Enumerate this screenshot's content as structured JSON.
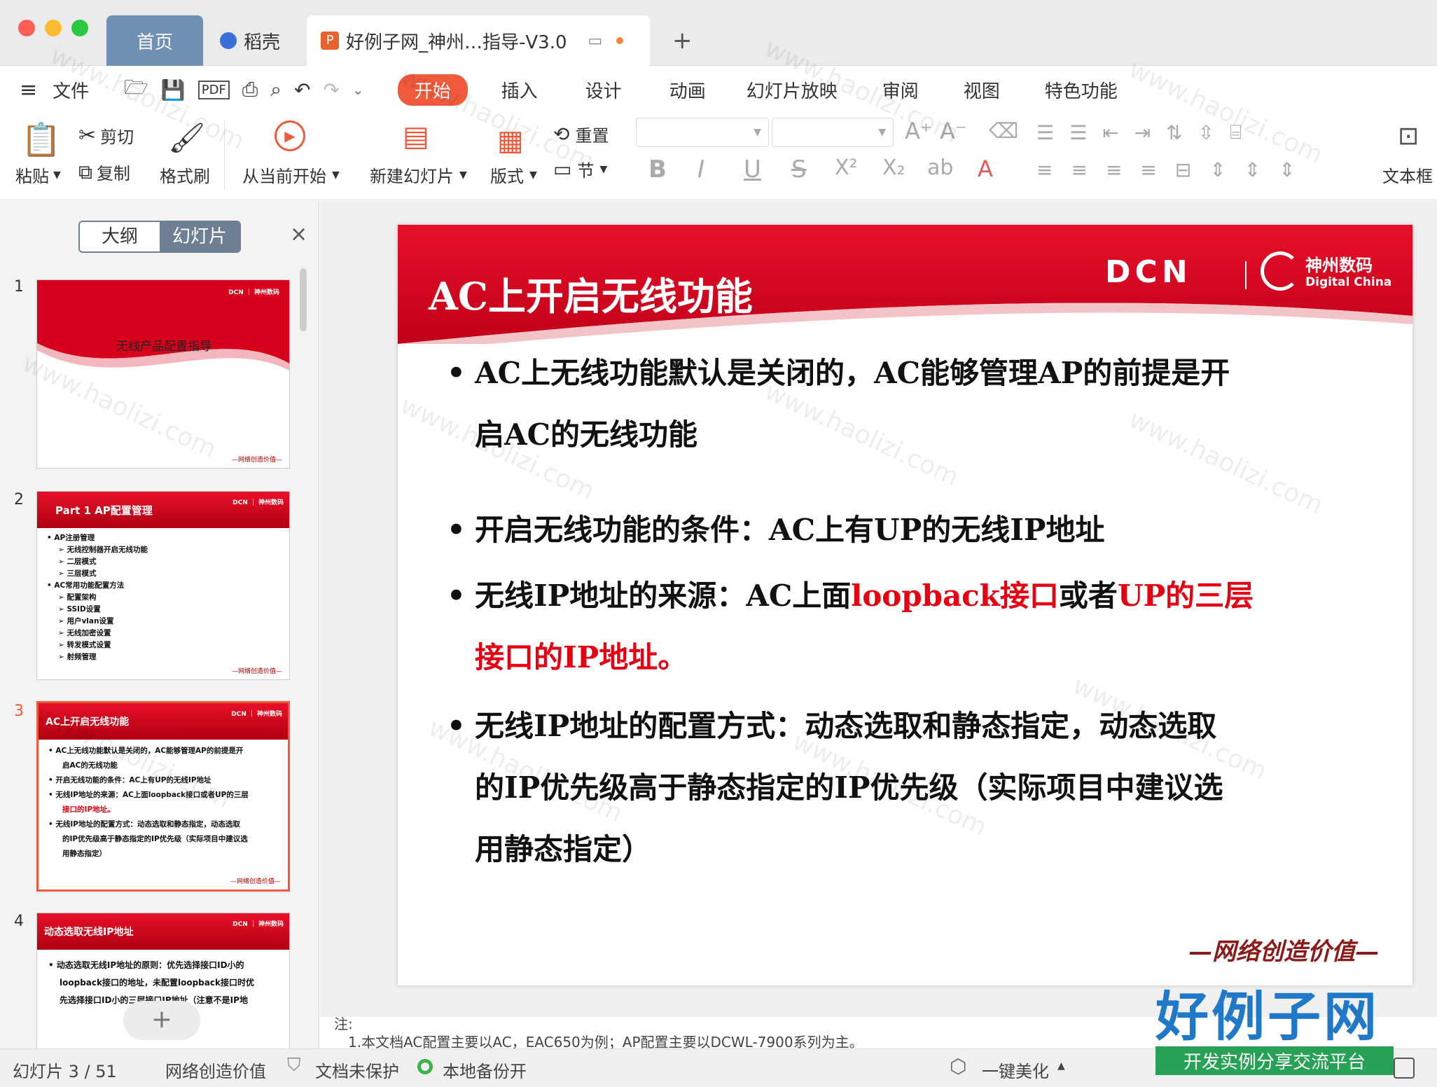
{
  "tabs": {
    "home": "首页",
    "dao": "稻壳",
    "doc": "好例子网_神州…指导-V3.0",
    "add": "+"
  },
  "menu": {
    "file": "文件",
    "items": [
      "开始",
      "插入",
      "设计",
      "动画",
      "幻灯片放映",
      "审阅",
      "视图",
      "特色功能"
    ]
  },
  "ribbon": {
    "paste": "粘贴",
    "cut": "剪切",
    "copy": "复制",
    "format_painter": "格式刷",
    "play_current": "从当前开始",
    "new_slide": "新建幻灯片",
    "layout": "版式",
    "reset": "重置",
    "section": "节",
    "textbox": "文本框",
    "font_name": "",
    "font_size": ""
  },
  "panel": {
    "outline": "大纲",
    "slides": "幻灯片",
    "close": "×",
    "add": "+"
  },
  "thumbs": [
    {
      "num": "1",
      "title": "无线产品配置指导",
      "footer": "—网络创造价值—"
    },
    {
      "num": "2",
      "title": "Part 1  AP配置管理",
      "lines": [
        "• AP注册管理",
        "➢ 无线控制器开启无线功能",
        "➢ 二层模式",
        "➢ 三层模式",
        "• AC常用功能配置方法",
        "➢ 配置架构",
        "➢ SSID设置",
        "➢ 用户vlan设置",
        "➢ 无线加密设置",
        "➢ 转发模式设置",
        "➢ 射频管理"
      ],
      "footer": "—网络创造价值—"
    },
    {
      "num": "3",
      "title": "AC上开启无线功能",
      "lines": [
        "• AC上无线功能默认是关闭的，AC能够管理AP的前提是开",
        "启AC的无线功能",
        "• 开启无线功能的条件：AC上有UP的无线IP地址",
        "• 无线IP地址的来源：AC上面loopback接口或者UP的三层",
        "接口的IP地址。",
        "• 无线IP地址的配置方式：动态选取和静态指定，动态选取",
        "的IP优先级高于静态指定的IP优先级（实际项目中建议选",
        "用静态指定）"
      ],
      "footer": "—网络创造价值—"
    },
    {
      "num": "4",
      "title": "动态选取无线IP地址",
      "lines": [
        "• 动态选取无线IP地址的原则：优先选择接口ID小的",
        "loopback接口的地址，未配置loopback接口时优",
        "先选择接口ID小的三层接口IP地址（注意不是IP地"
      ]
    }
  ],
  "slide": {
    "title": "AC上开启无线功能",
    "logo_dcn": "DCN",
    "logo_cn": "神州数码",
    "logo_en": "Digital China",
    "b1a": "AC上无线功能默认是关闭的，AC能够管理AP的前提是开",
    "b1b": "启AC的无线功能",
    "b2": "开启无线功能的条件：AC上有UP的无线IP地址",
    "b3_pre": "无线IP地址的来源：AC上面",
    "b3_red1": "loopback接口",
    "b3_mid": "或者",
    "b3_red2": "UP的三层",
    "b3b_red": "接口的IP地址。",
    "b4a": "无线IP地址的配置方式：动态选取和静态指定，动态选取",
    "b4b": "的IP优先级高于静态指定的IP优先级（实际项目中建议选",
    "b4c": "用静态指定）",
    "footer": "—网络创造价值—"
  },
  "notes": {
    "label": "注:",
    "text": "1.本文档AC配置主要以AC，EAC650为例；AP配置主要以DCWL-7900系列为主。"
  },
  "status": {
    "slide_pos": "幻灯片 3 / 51",
    "theme": "网络创造价值",
    "protect": "文档未保护",
    "backup": "本地备份开",
    "beautify": "一键美化"
  },
  "watermark": {
    "site": "www.haolizi.com",
    "brand": "好例子网",
    "brand_sub": "开发实例分享交流平台"
  },
  "colors": {
    "accent": "#e60012",
    "tab_active": "#f05a3c",
    "titlebar": "#ebebeb"
  }
}
